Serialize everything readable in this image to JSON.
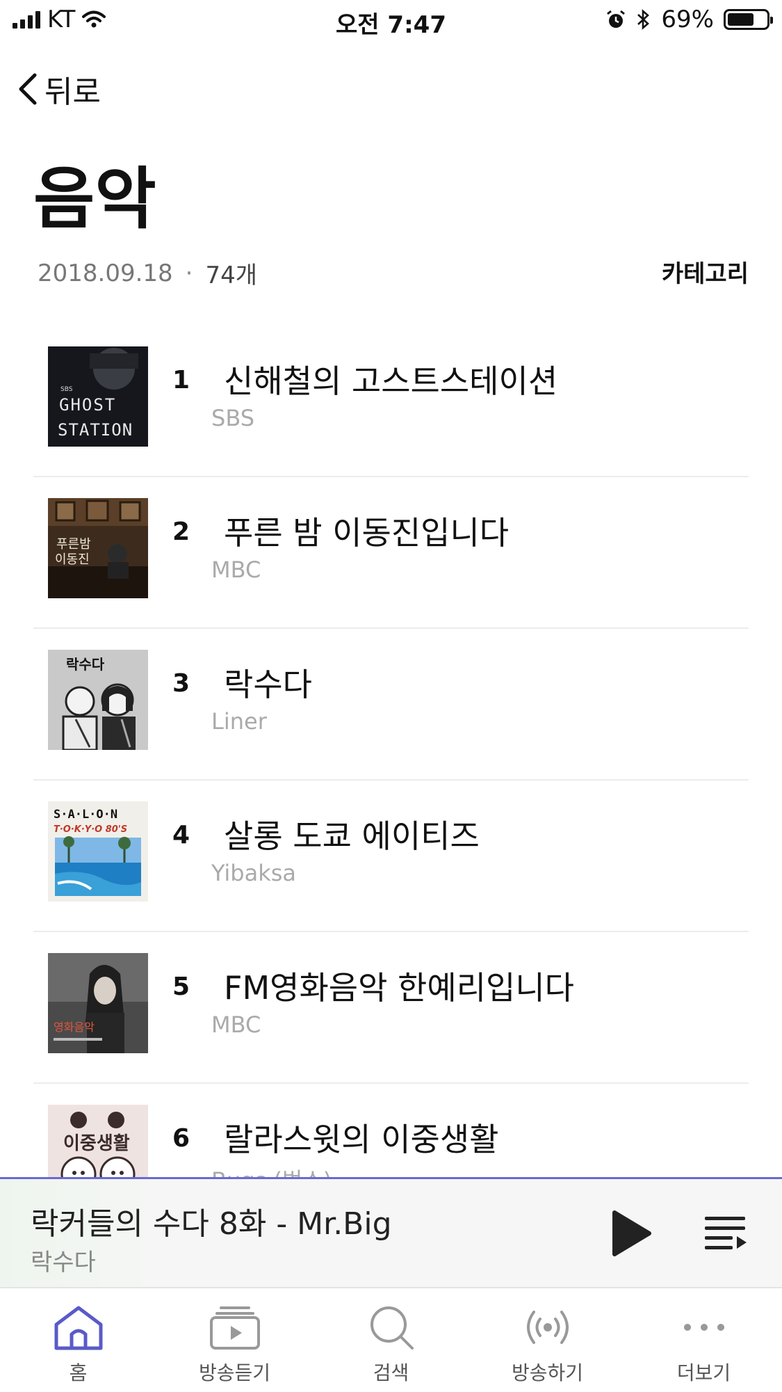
{
  "status_bar": {
    "carrier": "KT",
    "time": "오전 7:47",
    "battery_percent": "69%",
    "battery_level": 0.69
  },
  "nav": {
    "back_label": "뒤로"
  },
  "header": {
    "title": "음악",
    "date": "2018.09.18",
    "separator": "·",
    "count": "74개",
    "category_button": "카테고리"
  },
  "podcasts": [
    {
      "rank": "1",
      "title": "신해철의 고스트스테이션",
      "publisher": "SBS",
      "art": "ghost-station-cover",
      "art_text": [
        "SBS",
        "GHOST",
        "STATION"
      ]
    },
    {
      "rank": "2",
      "title": "푸른 밤 이동진입니다",
      "publisher": "MBC",
      "art": "blue-night-cover",
      "art_text": [
        "푸른밤",
        "이동진"
      ]
    },
    {
      "rank": "3",
      "title": "락수다",
      "publisher": "Liner",
      "art": "raksuda-cover",
      "art_text": [
        "락수다"
      ]
    },
    {
      "rank": "4",
      "title": "살롱 도쿄 에이티즈",
      "publisher": "Yibaksa",
      "art": "salon-tokyo-cover",
      "art_text": [
        "S·A·L·O·N",
        "T·O·K·Y·O 80'S"
      ]
    },
    {
      "rank": "5",
      "title": "FM영화음악 한예리입니다",
      "publisher": "MBC",
      "art": "fm-movie-music-cover",
      "art_text": [
        "영화음악"
      ]
    },
    {
      "rank": "6",
      "title": "랄라스윗의 이중생활",
      "publisher": "Bugs (벅스)",
      "art": "lalasweet-cover",
      "art_text": [
        "이중생활"
      ]
    }
  ],
  "now_playing": {
    "title": "락커들의 수다 8화 - Mr.Big",
    "show": "락수다",
    "play_icon": "play-icon",
    "queue_icon": "playlist-icon"
  },
  "tabs": [
    {
      "label": "홈",
      "icon": "home-icon",
      "active": true
    },
    {
      "label": "방송듣기",
      "icon": "radio-play-icon",
      "active": false
    },
    {
      "label": "검색",
      "icon": "search-icon",
      "active": false
    },
    {
      "label": "방송하기",
      "icon": "broadcast-icon",
      "active": false
    },
    {
      "label": "더보기",
      "icon": "more-icon",
      "active": false
    }
  ],
  "colors": {
    "accent": "#5a5ac8",
    "player_border": "#6a6ad2",
    "divider": "#ececec",
    "subtext": "#aaaaaa"
  }
}
